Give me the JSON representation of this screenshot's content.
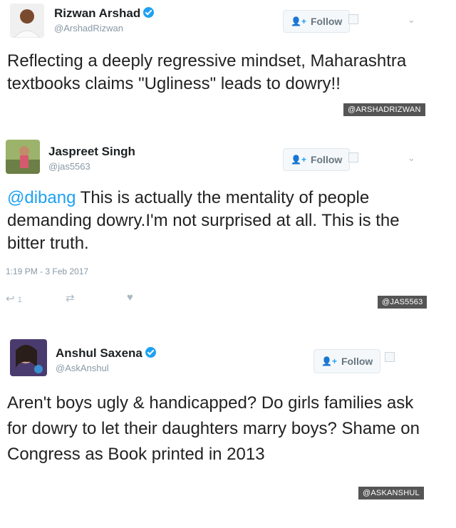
{
  "tweets": [
    {
      "name": "Rizwan Arshad",
      "handle": "@ArshadRizwan",
      "follow_label": "Follow",
      "text": "Reflecting a deeply regressive mindset, Maharashtra textbooks claims \"Ugliness\" leads to dowry!!",
      "credit": "@ARSHADRIZWAN",
      "verified": true
    },
    {
      "name": "Jaspreet Singh",
      "handle": "@jas5563",
      "follow_label": "Follow",
      "mention": "@dibang",
      "text": " This is actually the mentality of people demanding dowry.I'm not surprised at all. This is the bitter truth.",
      "timestamp": "1:19 PM - 3 Feb 2017",
      "reply_count": "1",
      "credit": "@JAS5563"
    },
    {
      "name": "Anshul Saxena",
      "handle": "@AskAnshul",
      "follow_label": "Follow",
      "text": "Aren't boys ugly & handicapped? Do girls families ask for dowry to let their daughters marry boys? Shame on Congress as Book printed in 2013",
      "credit": "@ASKANSHUL",
      "verified": true
    }
  ],
  "icons": {
    "follow": "person-plus-icon",
    "verified": "verified-badge-icon",
    "menu": "chevron-down-icon",
    "reply": "reply-icon",
    "retweet": "retweet-icon",
    "like": "heart-icon"
  },
  "colors": {
    "link": "#1da1f2",
    "credit_bg": "#555555"
  }
}
